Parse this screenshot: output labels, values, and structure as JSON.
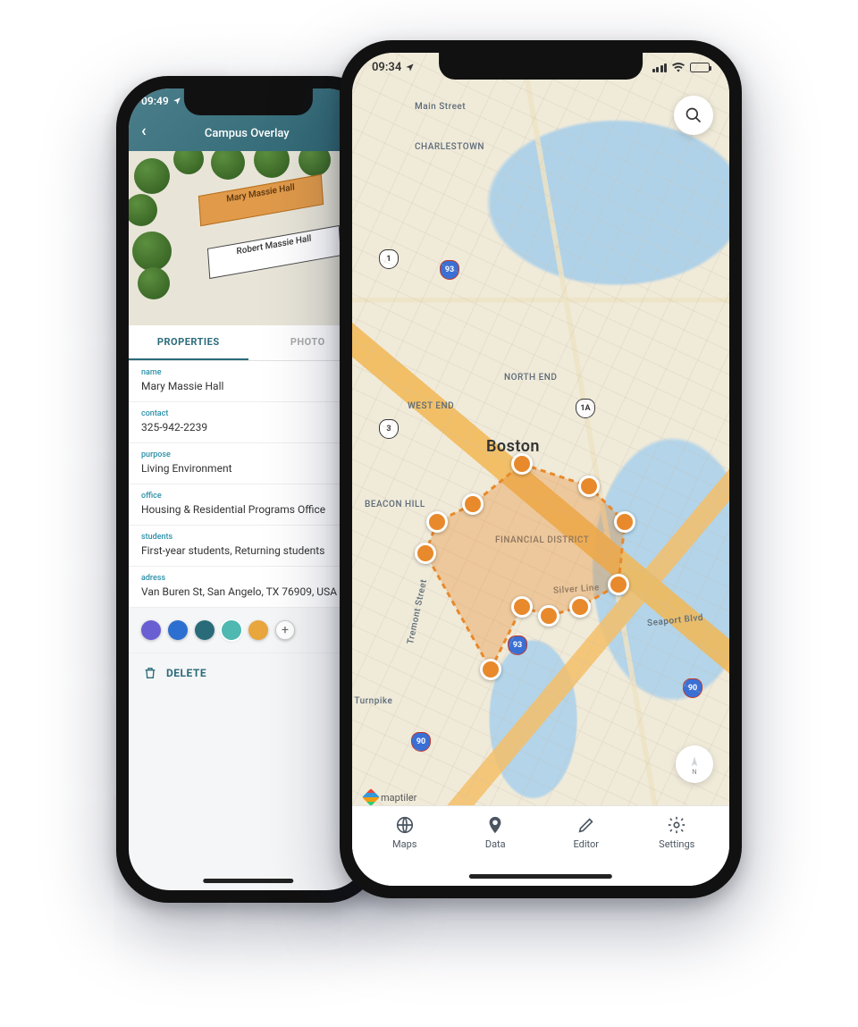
{
  "phoneA": {
    "status_time": "09:49",
    "header_title": "Campus Overlay",
    "buildings": {
      "selected": "Mary Massie Hall",
      "other": "Robert Massie Hall"
    },
    "tabs": {
      "active": "PROPERTIES",
      "inactive": "PHOTO"
    },
    "fields": [
      {
        "label": "name",
        "value": "Mary Massie Hall"
      },
      {
        "label": "contact",
        "value": "325-942-2239"
      },
      {
        "label": "purpose",
        "value": "Living Environment"
      },
      {
        "label": "office",
        "value": "Housing & Residential Programs Office"
      },
      {
        "label": "students",
        "value": "First-year students, Returning students"
      },
      {
        "label": "adress",
        "value": "Van Buren St, San Angelo, TX 76909, USA"
      }
    ],
    "colors": [
      "#6a5fd2",
      "#2d6fd0",
      "#2a6b7a",
      "#4fb8b0",
      "#e8a63d"
    ],
    "selected_color_index": 3,
    "delete_label": "DELETE"
  },
  "phoneB": {
    "status_time": "09:34",
    "city_label": "Boston",
    "districts": {
      "charlestown": "CHARLESTOWN",
      "northend": "NORTH END",
      "westend": "WEST END",
      "beaconhill": "BEACON HILL",
      "financial": "FINANCIAL DISTRICT",
      "seaport": "Seaport Blvd",
      "tremont": "Tremont Street",
      "silverline": "Silver Line",
      "turnpike": "s Turnpike",
      "mainst": "Main Street"
    },
    "shields": {
      "r1": "1",
      "r3": "3",
      "r1a": "1A",
      "i93a": "93",
      "i93b": "93",
      "i90a": "90",
      "i90b": "90"
    },
    "attribution": "maptiler",
    "compass": "N",
    "bottom": {
      "maps": "Maps",
      "data": "Data",
      "editor": "Editor",
      "settings": "Settings"
    }
  }
}
